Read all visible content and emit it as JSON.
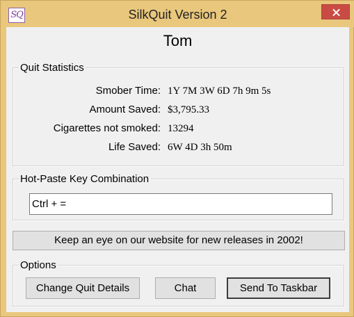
{
  "window": {
    "title": "SilkQuit Version 2",
    "icon_text": "SQ",
    "icon": "silkquit-app-icon",
    "close_icon": "close-icon"
  },
  "user_name": "Tom",
  "quit_statistics": {
    "legend": "Quit Statistics",
    "rows": [
      {
        "label": "Smober Time:",
        "value": "1Y 7M 3W 6D 7h 9m 5s"
      },
      {
        "label": "Amount Saved:",
        "value": "$3,795.33"
      },
      {
        "label": "Cigarettes not smoked:",
        "value": "13294"
      },
      {
        "label": "Life Saved:",
        "value": "6W 4D 3h 50m"
      }
    ]
  },
  "hotkey": {
    "legend": "Hot-Paste Key Combination",
    "value": "Ctrl + ="
  },
  "website_button_label": "Keep an eye on our website for new releases in 2002!",
  "options": {
    "legend": "Options",
    "change_details_label": "Change Quit Details",
    "chat_label": "Chat",
    "send_to_taskbar_label": "Send To Taskbar"
  },
  "colors": {
    "frame": "#e9c77c",
    "close_button": "#c94c44",
    "client_background": "#f0f0f0",
    "button_face": "#e1e1e1"
  }
}
